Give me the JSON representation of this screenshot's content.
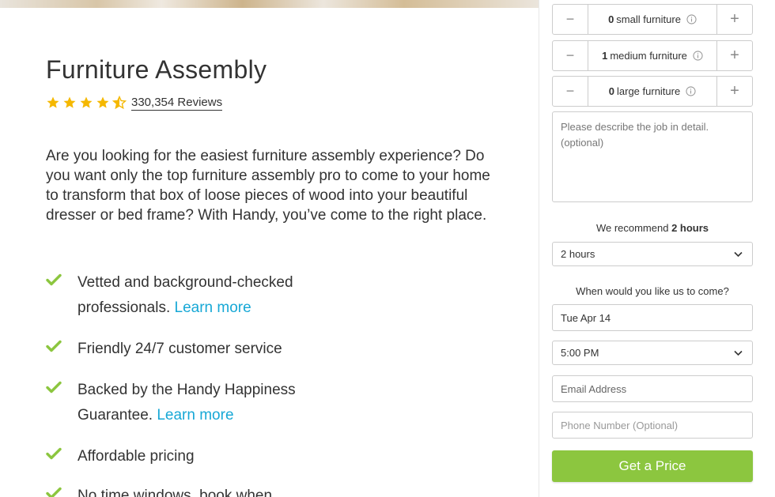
{
  "service": {
    "title": "Furniture Assembly",
    "rating": 4.5,
    "reviews_label": "330,354 Reviews",
    "intro": "Are you looking for the easiest furniture assembly experience? Do you want only the top furniture assembly pro to come to your home to transform that box of loose pieces of wood into your beautiful dresser or bed frame? With Handy, you’ve come to the right place.",
    "features": [
      {
        "text": "Vetted and background-checked professionals.",
        "link": "Learn more"
      },
      {
        "text": "Friendly 24/7 customer service",
        "link": ""
      },
      {
        "text": "Backed by the Handy Happiness Guarantee.",
        "link": "Learn more"
      },
      {
        "text": "Affordable pricing",
        "link": ""
      },
      {
        "text": "No time windows, book when",
        "link": ""
      }
    ]
  },
  "booking": {
    "steppers": [
      {
        "count": "0",
        "label": "small furniture"
      },
      {
        "count": "1",
        "label": "medium furniture"
      },
      {
        "count": "0",
        "label": "large furniture"
      }
    ],
    "minus_symbol": "−",
    "plus_symbol": "+",
    "details_placeholder": "Please describe the job in detail. (optional)",
    "recommend_prefix": "We recommend",
    "recommend_value": "2 hours",
    "hours_selected": "2 hours",
    "when_label": "When would you like us to come?",
    "date_value": "Tue Apr 14",
    "time_selected": "5:00 PM",
    "email_placeholder": "Email Address",
    "phone_placeholder": "Phone Number (Optional)",
    "cta_label": "Get a Price"
  },
  "colors": {
    "accent_green": "#8cc63f",
    "link_blue": "#17a8d6",
    "star_gold": "#f5b800"
  },
  "icons": {
    "star": "star-icon",
    "half_star": "half-star-icon",
    "check": "check-icon",
    "info": "info-icon",
    "chevron": "chevron-down-icon"
  }
}
